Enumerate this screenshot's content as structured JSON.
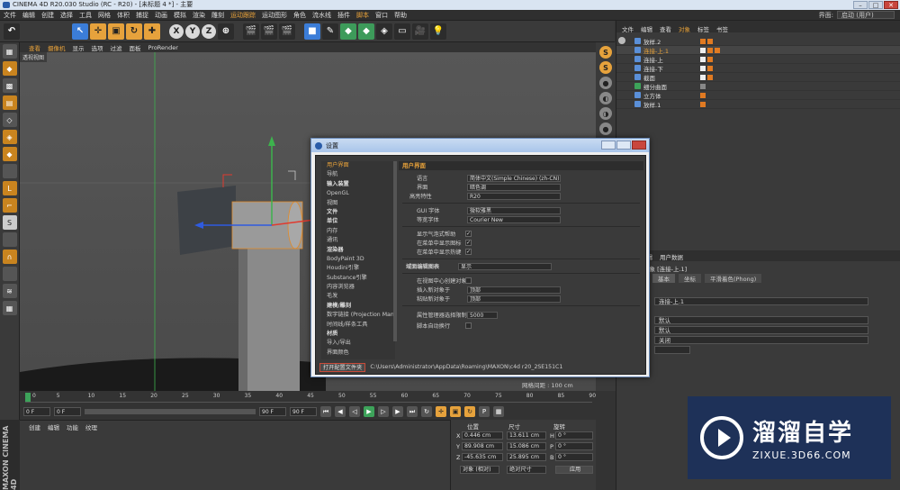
{
  "window": {
    "title": "CINEMA 4D R20.030 Studio (RC - R20) - [未标题 4 *] - 主要"
  },
  "menubar": {
    "items": [
      "文件",
      "编辑",
      "创建",
      "选择",
      "工具",
      "网格",
      "体积",
      "捕捉",
      "动画",
      "模拟",
      "渲染",
      "雕刻",
      "运动跟踪",
      "运动图形",
      "角色",
      "流水线",
      "插件",
      "脚本",
      "窗口",
      "帮助"
    ],
    "layout_label": "界面:",
    "layout_value": "启动 (用户)"
  },
  "viewport": {
    "menu": [
      "查看",
      "摄像机",
      "显示",
      "选项",
      "过滤",
      "面板",
      "ProRender"
    ],
    "label": "透视视图",
    "grid_spacing": "网格间距 : 100 cm"
  },
  "object_manager": {
    "tabs": [
      "文件",
      "编辑",
      "查看",
      "对象",
      "标签",
      "书签"
    ],
    "objects": [
      {
        "name": "放样.2"
      },
      {
        "name": "连接-上.1"
      },
      {
        "name": "连接-上"
      },
      {
        "name": "连接-下"
      },
      {
        "name": "截面"
      },
      {
        "name": "细分曲面"
      },
      {
        "name": "立方体"
      },
      {
        "name": "放样.1"
      }
    ]
  },
  "attribute_manager": {
    "tabs": [
      "模式",
      "编辑",
      "用户数据"
    ],
    "object_name": "对象 [连接-上.1]",
    "tabs2": [
      "基本",
      "坐标",
      "平滑着色(Phong)"
    ],
    "name_field": "连接-上.1",
    "field_default1": "默认",
    "field_default2": "默认",
    "field_off": "关闭",
    "field_blank": ""
  },
  "timeline": {
    "ticks": [
      "0",
      "5",
      "10",
      "15",
      "20",
      "25",
      "30",
      "35",
      "40",
      "45",
      "50",
      "55",
      "60",
      "65",
      "70",
      "75",
      "80",
      "85",
      "90"
    ],
    "start": "0 F",
    "current": "0 F",
    "end1": "90 F",
    "end2": "90 F"
  },
  "material_manager": {
    "tabs": [
      "创建",
      "编辑",
      "功能",
      "纹理"
    ],
    "brand": "MAXON CINEMA 4D"
  },
  "coordinates": {
    "headers": [
      "位置",
      "尺寸",
      "旋转"
    ],
    "rows": [
      {
        "axis": "X",
        "pos": "0.446 cm",
        "size": "13.611 cm",
        "rot_label": "H",
        "rot": "0 °"
      },
      {
        "axis": "Y",
        "pos": "89.908 cm",
        "size": "15.086 cm",
        "rot_label": "P",
        "rot": "0 °"
      },
      {
        "axis": "Z",
        "pos": "-45.635 cm",
        "size": "25.895 cm",
        "rot_label": "B",
        "rot": "0 °"
      }
    ],
    "mode1": "对象 (相对)",
    "mode2": "绝对尺寸",
    "apply": "应用"
  },
  "dialog": {
    "title": "设置",
    "categories": [
      "用户界面",
      "导航",
      "输入装置",
      "OpenGL",
      "视图",
      "文件",
      "单位",
      "内存",
      "通讯",
      "渲染器",
      "BodyPaint 3D",
      "Houdini引擎",
      "Substance引擎",
      "内容浏览器",
      "毛发",
      "建模/雕刻",
      "数字链接 (Projection Man)",
      "时间线/样条工具",
      "材质",
      "导入/导出",
      "界面颜色"
    ],
    "panel_title": "用户界面",
    "rows": {
      "language_label": "语言",
      "language_value": "简体中文(Simple Chinese) (zh-CN)",
      "interface_label": "界面",
      "interface_value": "暗色调",
      "highlight_label": "高亮特性",
      "highlight_value": "R20",
      "gui_font_label": "GUI 字体",
      "gui_font_value": "微软雅黑",
      "mono_font_label": "等宽字体",
      "mono_font_value": "Courier New",
      "bubble_help_label": "显示气泡式帮助",
      "menu_icons_label": "在菜单中显示图标",
      "menu_hotkeys_label": "在菜单中显示热键",
      "input_label": "域面编辑图表",
      "input_value": "显示",
      "cursor_info_label": "在视图中心创建对象",
      "paste_new_label": "插入新对象于",
      "paste_new_value": "顶部",
      "paste_obj_label": "粘贴新对象于",
      "paste_obj_value": "顶部",
      "attr_limit_label": "属性管理器选择限制",
      "attr_limit_value": "5000",
      "script_label": "脚本自动换行"
    },
    "open_folder_button": "打开配置文件夹",
    "path": "C:\\Users\\Administrator\\AppData\\Roaming\\MAXON\\c4d r20_2SE151C1"
  },
  "watermark": {
    "cn": "溜溜自学",
    "url": "ZIXUE.3D66.COM"
  }
}
